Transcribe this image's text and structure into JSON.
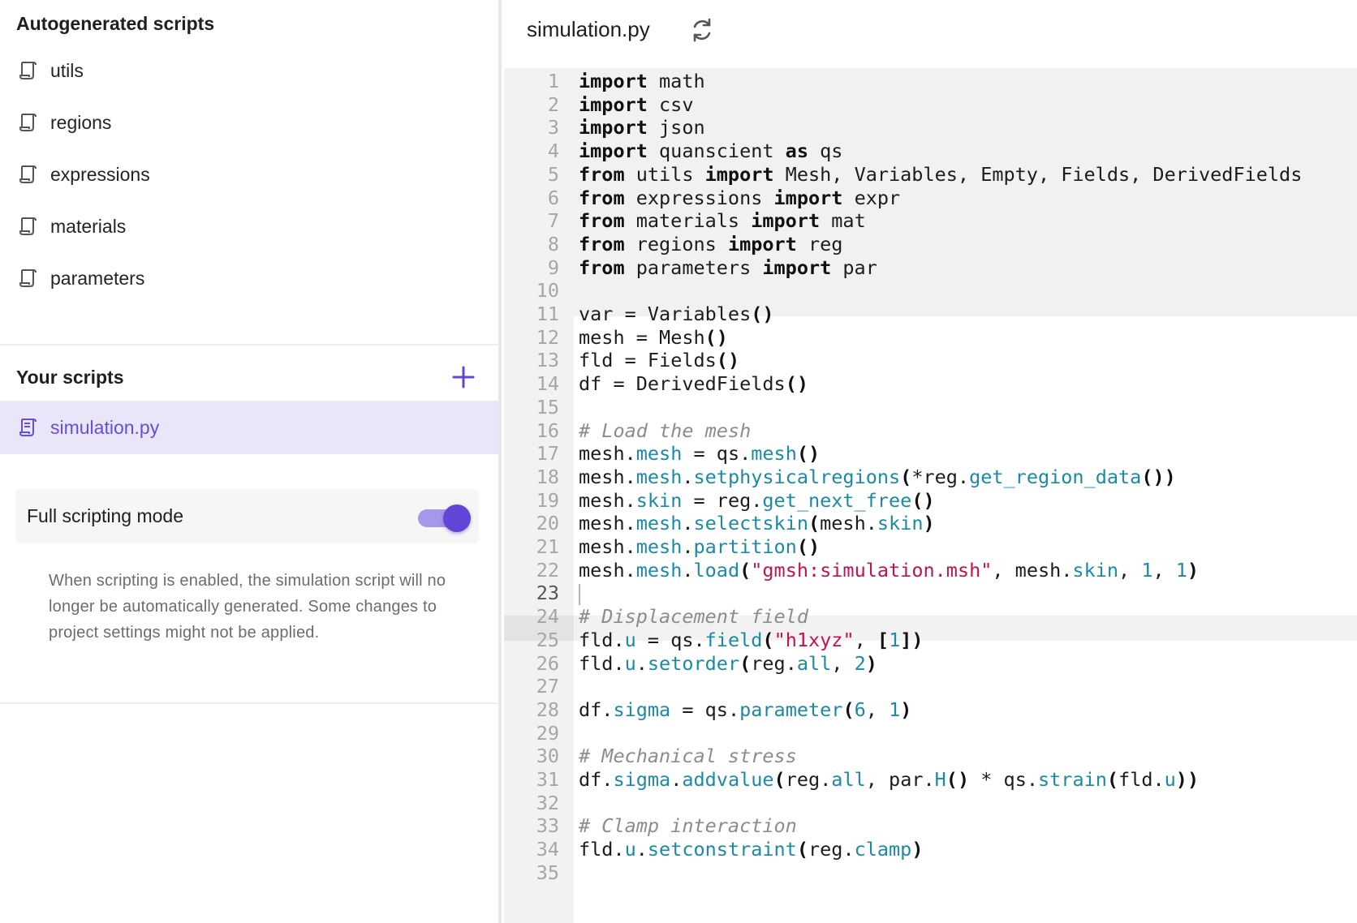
{
  "sidebar": {
    "autogen_title": "Autogenerated scripts",
    "autogen_items": [
      {
        "label": "utils"
      },
      {
        "label": "regions"
      },
      {
        "label": "expressions"
      },
      {
        "label": "materials"
      },
      {
        "label": "parameters"
      }
    ],
    "your_scripts_title": "Your scripts",
    "your_items": [
      {
        "label": "simulation.py",
        "selected": true
      }
    ],
    "full_scripting": {
      "label": "Full scripting mode",
      "enabled": true,
      "description": "When scripting is enabled, the simulation script will no longer be automatically generated. Some changes to project settings might not be applied."
    }
  },
  "editor": {
    "file_name": "simulation.py",
    "active_line": 23,
    "lines": [
      [
        [
          "kw",
          "import"
        ],
        [
          "id",
          " math"
        ]
      ],
      [
        [
          "kw",
          "import"
        ],
        [
          "id",
          " csv"
        ]
      ],
      [
        [
          "kw",
          "import"
        ],
        [
          "id",
          " json"
        ]
      ],
      [
        [
          "kw",
          "import"
        ],
        [
          "id",
          " quanscient "
        ],
        [
          "kw",
          "as"
        ],
        [
          "id",
          " qs"
        ]
      ],
      [
        [
          "kw",
          "from"
        ],
        [
          "id",
          " utils "
        ],
        [
          "kw",
          "import"
        ],
        [
          "id",
          " Mesh, Variables, Empty, Fields, DerivedFields"
        ]
      ],
      [
        [
          "kw",
          "from"
        ],
        [
          "id",
          " expressions "
        ],
        [
          "kw",
          "import"
        ],
        [
          "id",
          " expr"
        ]
      ],
      [
        [
          "kw",
          "from"
        ],
        [
          "id",
          " materials "
        ],
        [
          "kw",
          "import"
        ],
        [
          "id",
          " mat"
        ]
      ],
      [
        [
          "kw",
          "from"
        ],
        [
          "id",
          " regions "
        ],
        [
          "kw",
          "import"
        ],
        [
          "id",
          " reg"
        ]
      ],
      [
        [
          "kw",
          "from"
        ],
        [
          "id",
          " parameters "
        ],
        [
          "kw",
          "import"
        ],
        [
          "id",
          " par"
        ]
      ],
      [],
      [
        [
          "id",
          "var "
        ],
        [
          "op",
          "="
        ],
        [
          "id",
          " Variables"
        ],
        [
          "p",
          "()"
        ]
      ],
      [
        [
          "id",
          "mesh "
        ],
        [
          "op",
          "="
        ],
        [
          "id",
          " Mesh"
        ],
        [
          "p",
          "()"
        ]
      ],
      [
        [
          "id",
          "fld "
        ],
        [
          "op",
          "="
        ],
        [
          "id",
          " Fields"
        ],
        [
          "p",
          "()"
        ]
      ],
      [
        [
          "id",
          "df "
        ],
        [
          "op",
          "="
        ],
        [
          "id",
          " DerivedFields"
        ],
        [
          "p",
          "()"
        ]
      ],
      [],
      [
        [
          "com",
          "# Load the mesh"
        ]
      ],
      [
        [
          "id",
          "mesh."
        ],
        [
          "attr",
          "mesh"
        ],
        [
          "op",
          " = "
        ],
        [
          "id",
          "qs."
        ],
        [
          "attr",
          "mesh"
        ],
        [
          "p",
          "()"
        ]
      ],
      [
        [
          "id",
          "mesh."
        ],
        [
          "attr",
          "mesh"
        ],
        [
          "id",
          "."
        ],
        [
          "attr",
          "setphysicalregions"
        ],
        [
          "p",
          "("
        ],
        [
          "op",
          "*"
        ],
        [
          "id",
          "reg."
        ],
        [
          "attr",
          "get_region_data"
        ],
        [
          "p",
          "())"
        ]
      ],
      [
        [
          "id",
          "mesh."
        ],
        [
          "attr",
          "skin"
        ],
        [
          "op",
          " = "
        ],
        [
          "id",
          "reg."
        ],
        [
          "attr",
          "get_next_free"
        ],
        [
          "p",
          "()"
        ]
      ],
      [
        [
          "id",
          "mesh."
        ],
        [
          "attr",
          "mesh"
        ],
        [
          "id",
          "."
        ],
        [
          "attr",
          "selectskin"
        ],
        [
          "p",
          "("
        ],
        [
          "id",
          "mesh."
        ],
        [
          "attr",
          "skin"
        ],
        [
          "p",
          ")"
        ]
      ],
      [
        [
          "id",
          "mesh."
        ],
        [
          "attr",
          "mesh"
        ],
        [
          "id",
          "."
        ],
        [
          "attr",
          "partition"
        ],
        [
          "p",
          "()"
        ]
      ],
      [
        [
          "id",
          "mesh."
        ],
        [
          "attr",
          "mesh"
        ],
        [
          "id",
          "."
        ],
        [
          "attr",
          "load"
        ],
        [
          "p",
          "("
        ],
        [
          "str",
          "\"gmsh:simulation.msh\""
        ],
        [
          "id",
          ", mesh."
        ],
        [
          "attr",
          "skin"
        ],
        [
          "id",
          ", "
        ],
        [
          "num",
          "1"
        ],
        [
          "id",
          ", "
        ],
        [
          "num",
          "1"
        ],
        [
          "p",
          ")"
        ]
      ],
      [],
      [
        [
          "com",
          "# Displacement field"
        ]
      ],
      [
        [
          "id",
          "fld."
        ],
        [
          "attr",
          "u"
        ],
        [
          "op",
          " = "
        ],
        [
          "id",
          "qs."
        ],
        [
          "attr",
          "field"
        ],
        [
          "p",
          "("
        ],
        [
          "str",
          "\"h1xyz\""
        ],
        [
          "id",
          ", "
        ],
        [
          "p",
          "["
        ],
        [
          "num",
          "1"
        ],
        [
          "p",
          "])"
        ]
      ],
      [
        [
          "id",
          "fld."
        ],
        [
          "attr",
          "u"
        ],
        [
          "id",
          "."
        ],
        [
          "attr",
          "setorder"
        ],
        [
          "p",
          "("
        ],
        [
          "id",
          "reg."
        ],
        [
          "attr",
          "all"
        ],
        [
          "id",
          ", "
        ],
        [
          "num",
          "2"
        ],
        [
          "p",
          ")"
        ]
      ],
      [],
      [
        [
          "id",
          "df."
        ],
        [
          "attr",
          "sigma"
        ],
        [
          "op",
          " = "
        ],
        [
          "id",
          "qs."
        ],
        [
          "attr",
          "parameter"
        ],
        [
          "p",
          "("
        ],
        [
          "num",
          "6"
        ],
        [
          "id",
          ", "
        ],
        [
          "num",
          "1"
        ],
        [
          "p",
          ")"
        ]
      ],
      [],
      [
        [
          "com",
          "# Mechanical stress"
        ]
      ],
      [
        [
          "id",
          "df."
        ],
        [
          "attr",
          "sigma"
        ],
        [
          "id",
          "."
        ],
        [
          "attr",
          "addvalue"
        ],
        [
          "p",
          "("
        ],
        [
          "id",
          "reg."
        ],
        [
          "attr",
          "all"
        ],
        [
          "id",
          ", par."
        ],
        [
          "attr",
          "H"
        ],
        [
          "p",
          "()"
        ],
        [
          "op",
          " * "
        ],
        [
          "id",
          "qs."
        ],
        [
          "attr",
          "strain"
        ],
        [
          "p",
          "("
        ],
        [
          "id",
          "fld."
        ],
        [
          "attr",
          "u"
        ],
        [
          "p",
          "))"
        ]
      ],
      [],
      [
        [
          "com",
          "# Clamp interaction"
        ]
      ],
      [
        [
          "id",
          "fld."
        ],
        [
          "attr",
          "u"
        ],
        [
          "id",
          "."
        ],
        [
          "attr",
          "setconstraint"
        ],
        [
          "p",
          "("
        ],
        [
          "id",
          "reg."
        ],
        [
          "attr",
          "clamp"
        ],
        [
          "p",
          ")"
        ]
      ],
      []
    ],
    "line_numbers": [
      "1",
      "2",
      "3",
      "4",
      "5",
      "6",
      "7",
      "8",
      "9",
      "10",
      "11",
      "12",
      "13",
      "14",
      "15",
      "16",
      "17",
      "18",
      "19",
      "20",
      "21",
      "22",
      "23",
      "24",
      "25",
      "26",
      "27",
      "28",
      "29",
      "30",
      "31",
      "32",
      "33",
      "34",
      "35"
    ]
  },
  "colors": {
    "accent": "#6244d7",
    "accent_light": "#a797ea",
    "selected_bg": "#e9e6fa",
    "attr": "#1b8aa3",
    "string": "#c0144d",
    "comment": "#8c8c8c"
  },
  "icons": {
    "script": "script-icon",
    "add": "plus-icon",
    "refresh": "refresh-icon"
  }
}
